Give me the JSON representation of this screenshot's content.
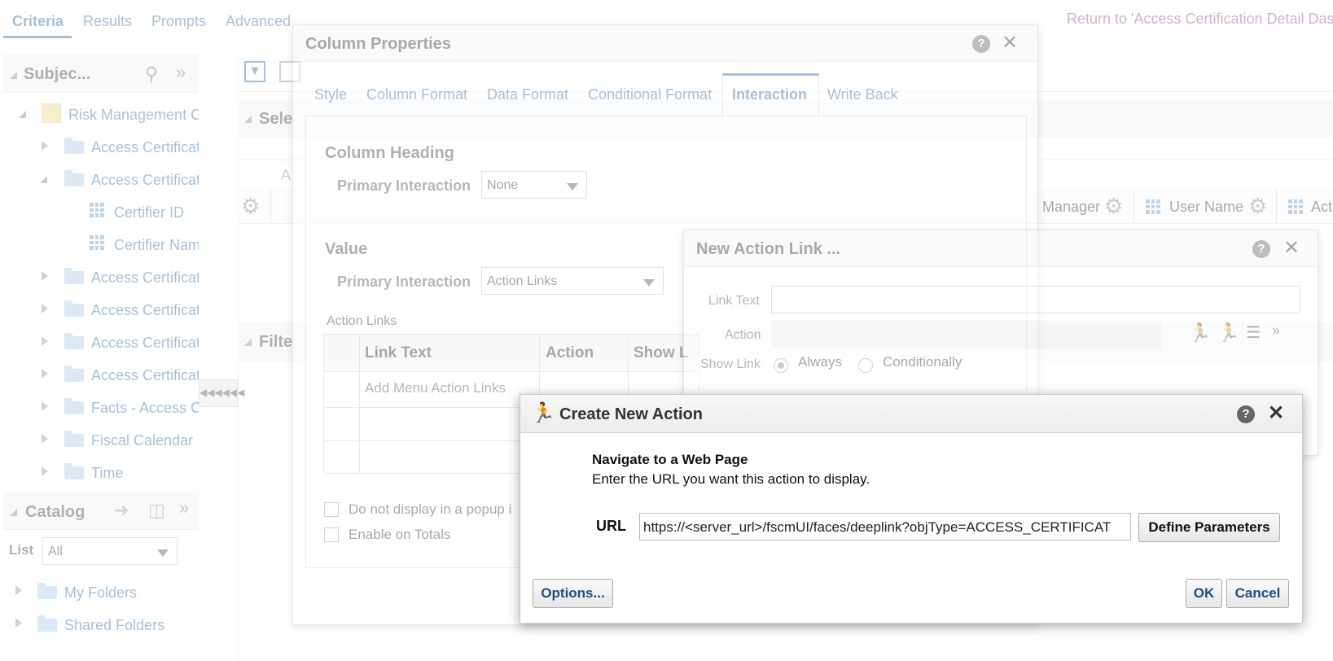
{
  "top_tabs": {
    "criteria": "Criteria",
    "results": "Results",
    "prompts": "Prompts",
    "advanced": "Advanced"
  },
  "return_link": "Return to 'Access Certification Detail Das",
  "subject_pane": {
    "title": "Subjec...",
    "tree": {
      "root": "Risk Management C",
      "items": [
        "Access Certificat",
        "Access Certificat",
        "Certifier ID",
        "Certifier Nam",
        "Access Certificat",
        "Access Certificat",
        "Access Certificat",
        "Access Certificat",
        "Facts - Access C",
        "Fiscal Calendar",
        "Time"
      ]
    }
  },
  "catalog_pane": {
    "title": "Catalog",
    "list_label": "List",
    "list_value": "All",
    "folders": [
      "My Folders",
      "Shared Folders"
    ]
  },
  "background": {
    "section_selected": "Sele",
    "section_filters": "Filte",
    "col_header_a": "A",
    "columns": [
      "Manager",
      "User Name",
      "Act"
    ]
  },
  "column_properties": {
    "title": "Column Properties",
    "tabs": [
      "Style",
      "Column Format",
      "Data Format",
      "Conditional Format",
      "Interaction",
      "Write Back"
    ],
    "column_heading": {
      "section": "Column Heading",
      "label": "Primary Interaction",
      "value": "None"
    },
    "value": {
      "section": "Value",
      "label": "Primary Interaction",
      "value": "Action Links"
    },
    "action_links": {
      "label": "Action Links",
      "headers": [
        "Link Text",
        "Action",
        "Show L"
      ],
      "placeholder": "Add Menu Action Links"
    },
    "chk_popup": "Do not display in a popup i",
    "chk_totals": "Enable on Totals"
  },
  "new_action_link": {
    "title": "New Action Link ...",
    "link_text_label": "Link Text",
    "action_label": "Action",
    "show_link_label": "Show Link",
    "always": "Always",
    "conditionally": "Conditionally"
  },
  "create_new_action": {
    "title": "Create New Action",
    "heading": "Navigate to a Web Page",
    "instruction": "Enter the URL you want this action to display.",
    "url_label": "URL",
    "url_value": "https://<server_url>/fscmUI/faces/deeplink?objType=ACCESS_CERTIFICAT",
    "define_params": "Define Parameters",
    "options": "Options...",
    "ok": "OK",
    "cancel": "Cancel"
  },
  "colors": {
    "accent": "#2e6aa8",
    "link_purple": "#8a4c8a",
    "folder": "#a9cbe8",
    "button_text": "#1f4e86"
  }
}
